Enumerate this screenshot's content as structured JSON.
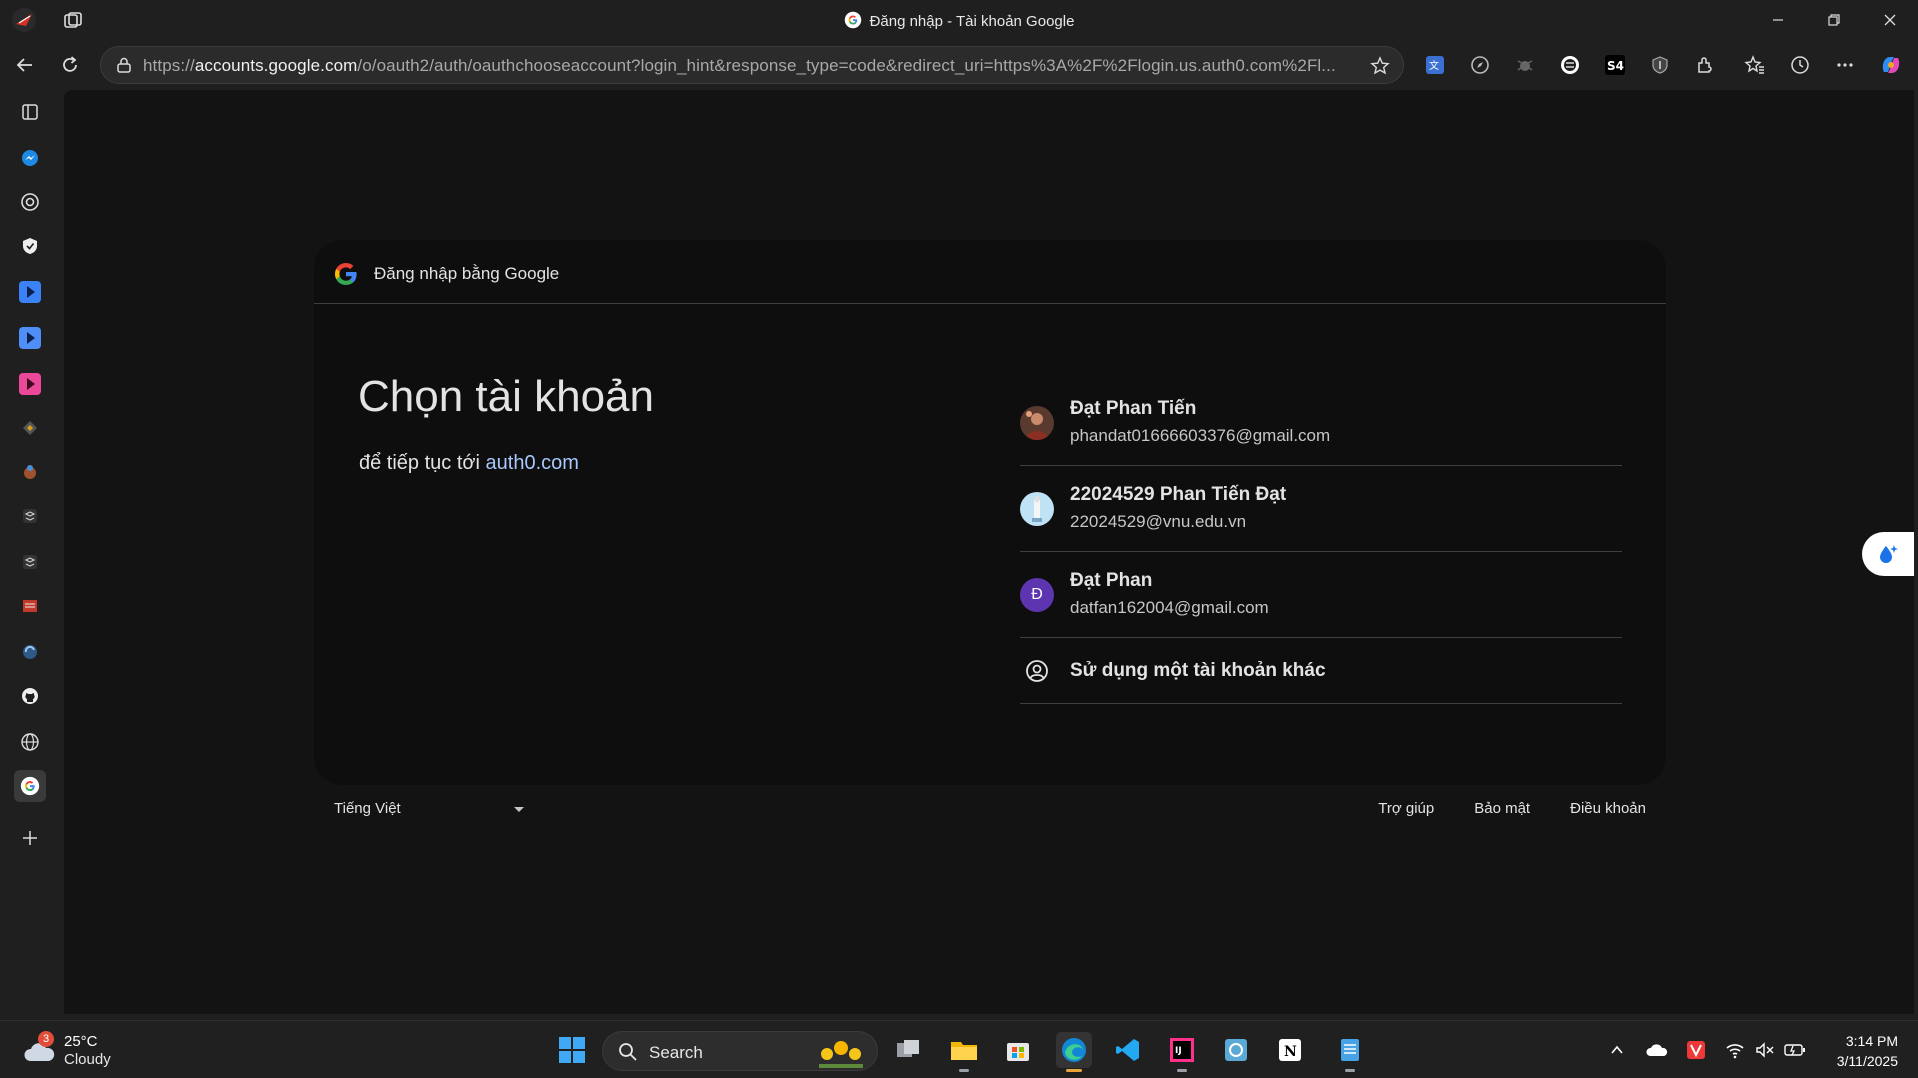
{
  "window": {
    "title": "Đăng nhập - Tài khoản Google"
  },
  "toolbar": {
    "url_host": "accounts.google.com",
    "url_prefix": "https://",
    "url_path": "/o/oauth2/auth/oauthchooseaccount?login_hint&response_type=code&redirect_uri=https%3A%2F%2Flogin.us.auth0.com%2Fl..."
  },
  "card": {
    "header_label": "Đăng nhập bằng Google",
    "heading": "Chọn tài khoản",
    "subtitle_prefix": "để tiếp tục tới ",
    "subtitle_link": "auth0.com",
    "accounts": [
      {
        "name": "Đạt Phan Tiến",
        "email": "phandat01666603376@gmail.com",
        "avatar": "photo"
      },
      {
        "name": "22024529 Phan Tiến Đạt",
        "email": "22024529@vnu.edu.vn",
        "avatar": "photo"
      },
      {
        "name": "Đạt Phan",
        "email": "datfan162004@gmail.com",
        "avatar_letter": "Đ",
        "avatar_color": "#5e35b1"
      }
    ],
    "other_account": "Sử dụng một tài khoản khác"
  },
  "footer": {
    "language": "Tiếng Việt",
    "links": [
      "Trợ giúp",
      "Bảo mật",
      "Điều khoản"
    ]
  },
  "taskbar": {
    "weather_temp": "25°C",
    "weather_cond": "Cloudy",
    "weather_badge": "3",
    "search_label": "Search",
    "time": "3:14 PM",
    "date": "3/11/2025"
  },
  "colors": {
    "link": "#a8c7fa",
    "card_bg": "#0e0e0e",
    "page_bg": "#131314"
  }
}
